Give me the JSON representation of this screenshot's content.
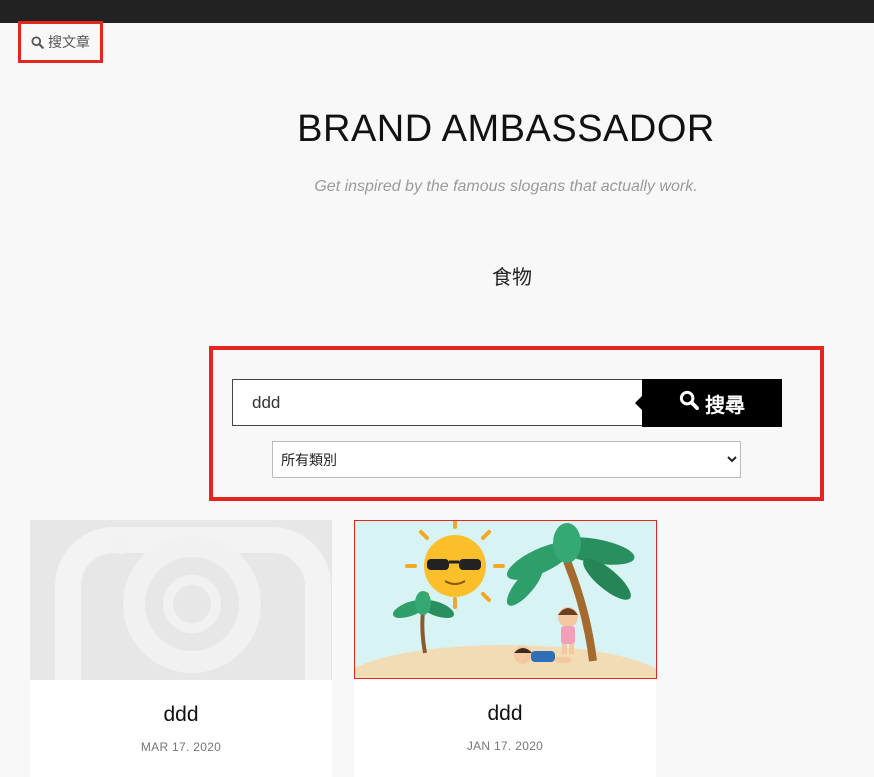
{
  "header": {
    "search_toggle_label": "搜文章",
    "site_title": "BRAND AMBASSADOR",
    "tagline": "Get inspired by the famous slogans that actually work."
  },
  "category": {
    "title": "食物"
  },
  "search": {
    "input_value": "ddd",
    "button_label": "搜尋",
    "select_options": [
      "所有類別"
    ],
    "selected_option": "所有類別"
  },
  "posts": [
    {
      "title": "ddd",
      "date": "MAR 17. 2020",
      "image": "camera-placeholder"
    },
    {
      "title": "ddd",
      "date": "JAN 17. 2020",
      "image": "beach-illustration"
    }
  ],
  "colors": {
    "topbar": "#222222",
    "highlight_border": "#e3261f",
    "button_bg": "#000000",
    "page_bg": "#f8f8f8"
  },
  "icons": {
    "search_toggle": "search-icon",
    "search_button": "search-icon"
  }
}
